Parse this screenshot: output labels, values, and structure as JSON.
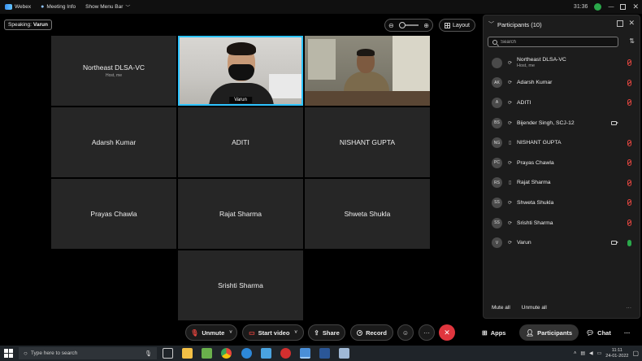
{
  "topbar": {
    "app_name": "Webex",
    "meeting_info": "Meeting Info",
    "show_menu_bar": "Show Menu Bar",
    "time": "31:36"
  },
  "speaking": {
    "label": "Speaking:",
    "name": "Varun"
  },
  "layout_label": "Layout",
  "zoom_level": 0,
  "tiles": [
    {
      "name": "Northeast DLSA-VC",
      "sub": "Host, me"
    },
    {
      "name": "Varun",
      "video": true,
      "active": true
    },
    {
      "name": "",
      "video": true
    },
    {
      "name": "Adarsh Kumar"
    },
    {
      "name": "ADITI"
    },
    {
      "name": "NISHANT GUPTA"
    },
    {
      "name": "Prayas Chawla"
    },
    {
      "name": "Rajat Sharma"
    },
    {
      "name": "Shweta Shukla"
    },
    {
      "name": "Srishti Sharma"
    }
  ],
  "participants": {
    "title": "Participants (10)",
    "search_placeholder": "Search",
    "list": [
      {
        "initials": "",
        "name": "Northeast DLSA-VC",
        "role": "Host, me",
        "device": "sync-icon",
        "mic": "muted",
        "camera": false
      },
      {
        "initials": "AK",
        "name": "Adarsh Kumar",
        "device": "sync-icon",
        "mic": "muted",
        "camera": false
      },
      {
        "initials": "A",
        "name": "ADITI",
        "device": "sync-icon",
        "mic": "muted",
        "camera": false
      },
      {
        "initials": "BS",
        "name": "Bijender Singh, SCJ-12",
        "device": "sync-icon",
        "mic": "none",
        "camera": true
      },
      {
        "initials": "NG",
        "name": "NISHANT GUPTA",
        "device": "phone-icon",
        "mic": "muted",
        "camera": false
      },
      {
        "initials": "PC",
        "name": "Prayas Chawla",
        "device": "sync-icon",
        "mic": "muted",
        "camera": false
      },
      {
        "initials": "RS",
        "name": "Rajat Sharma",
        "device": "phone-icon",
        "mic": "muted",
        "camera": false
      },
      {
        "initials": "SS",
        "name": "Shweta Shukla",
        "device": "sync-icon",
        "mic": "muted",
        "camera": false
      },
      {
        "initials": "SS",
        "name": "Srishti Sharma",
        "device": "sync-icon",
        "mic": "muted",
        "camera": false
      },
      {
        "initials": "V",
        "name": "Varun",
        "device": "sync-icon",
        "mic": "on",
        "camera": true
      }
    ],
    "mute_all": "Mute all",
    "unmute_all": "Unmute all"
  },
  "controls": {
    "unmute": "Unmute",
    "start_video": "Start video",
    "share": "Share",
    "record": "Record",
    "apps": "Apps",
    "participants": "Participants",
    "chat": "Chat"
  },
  "taskbar": {
    "search_placeholder": "Type here to search",
    "time": "11:11",
    "date": "24-01-2022"
  },
  "colors": {
    "accent": "#2ec4ff",
    "mute_red": "#e0443e",
    "end_red": "#e0363e",
    "mic_green": "#2aa84a"
  }
}
